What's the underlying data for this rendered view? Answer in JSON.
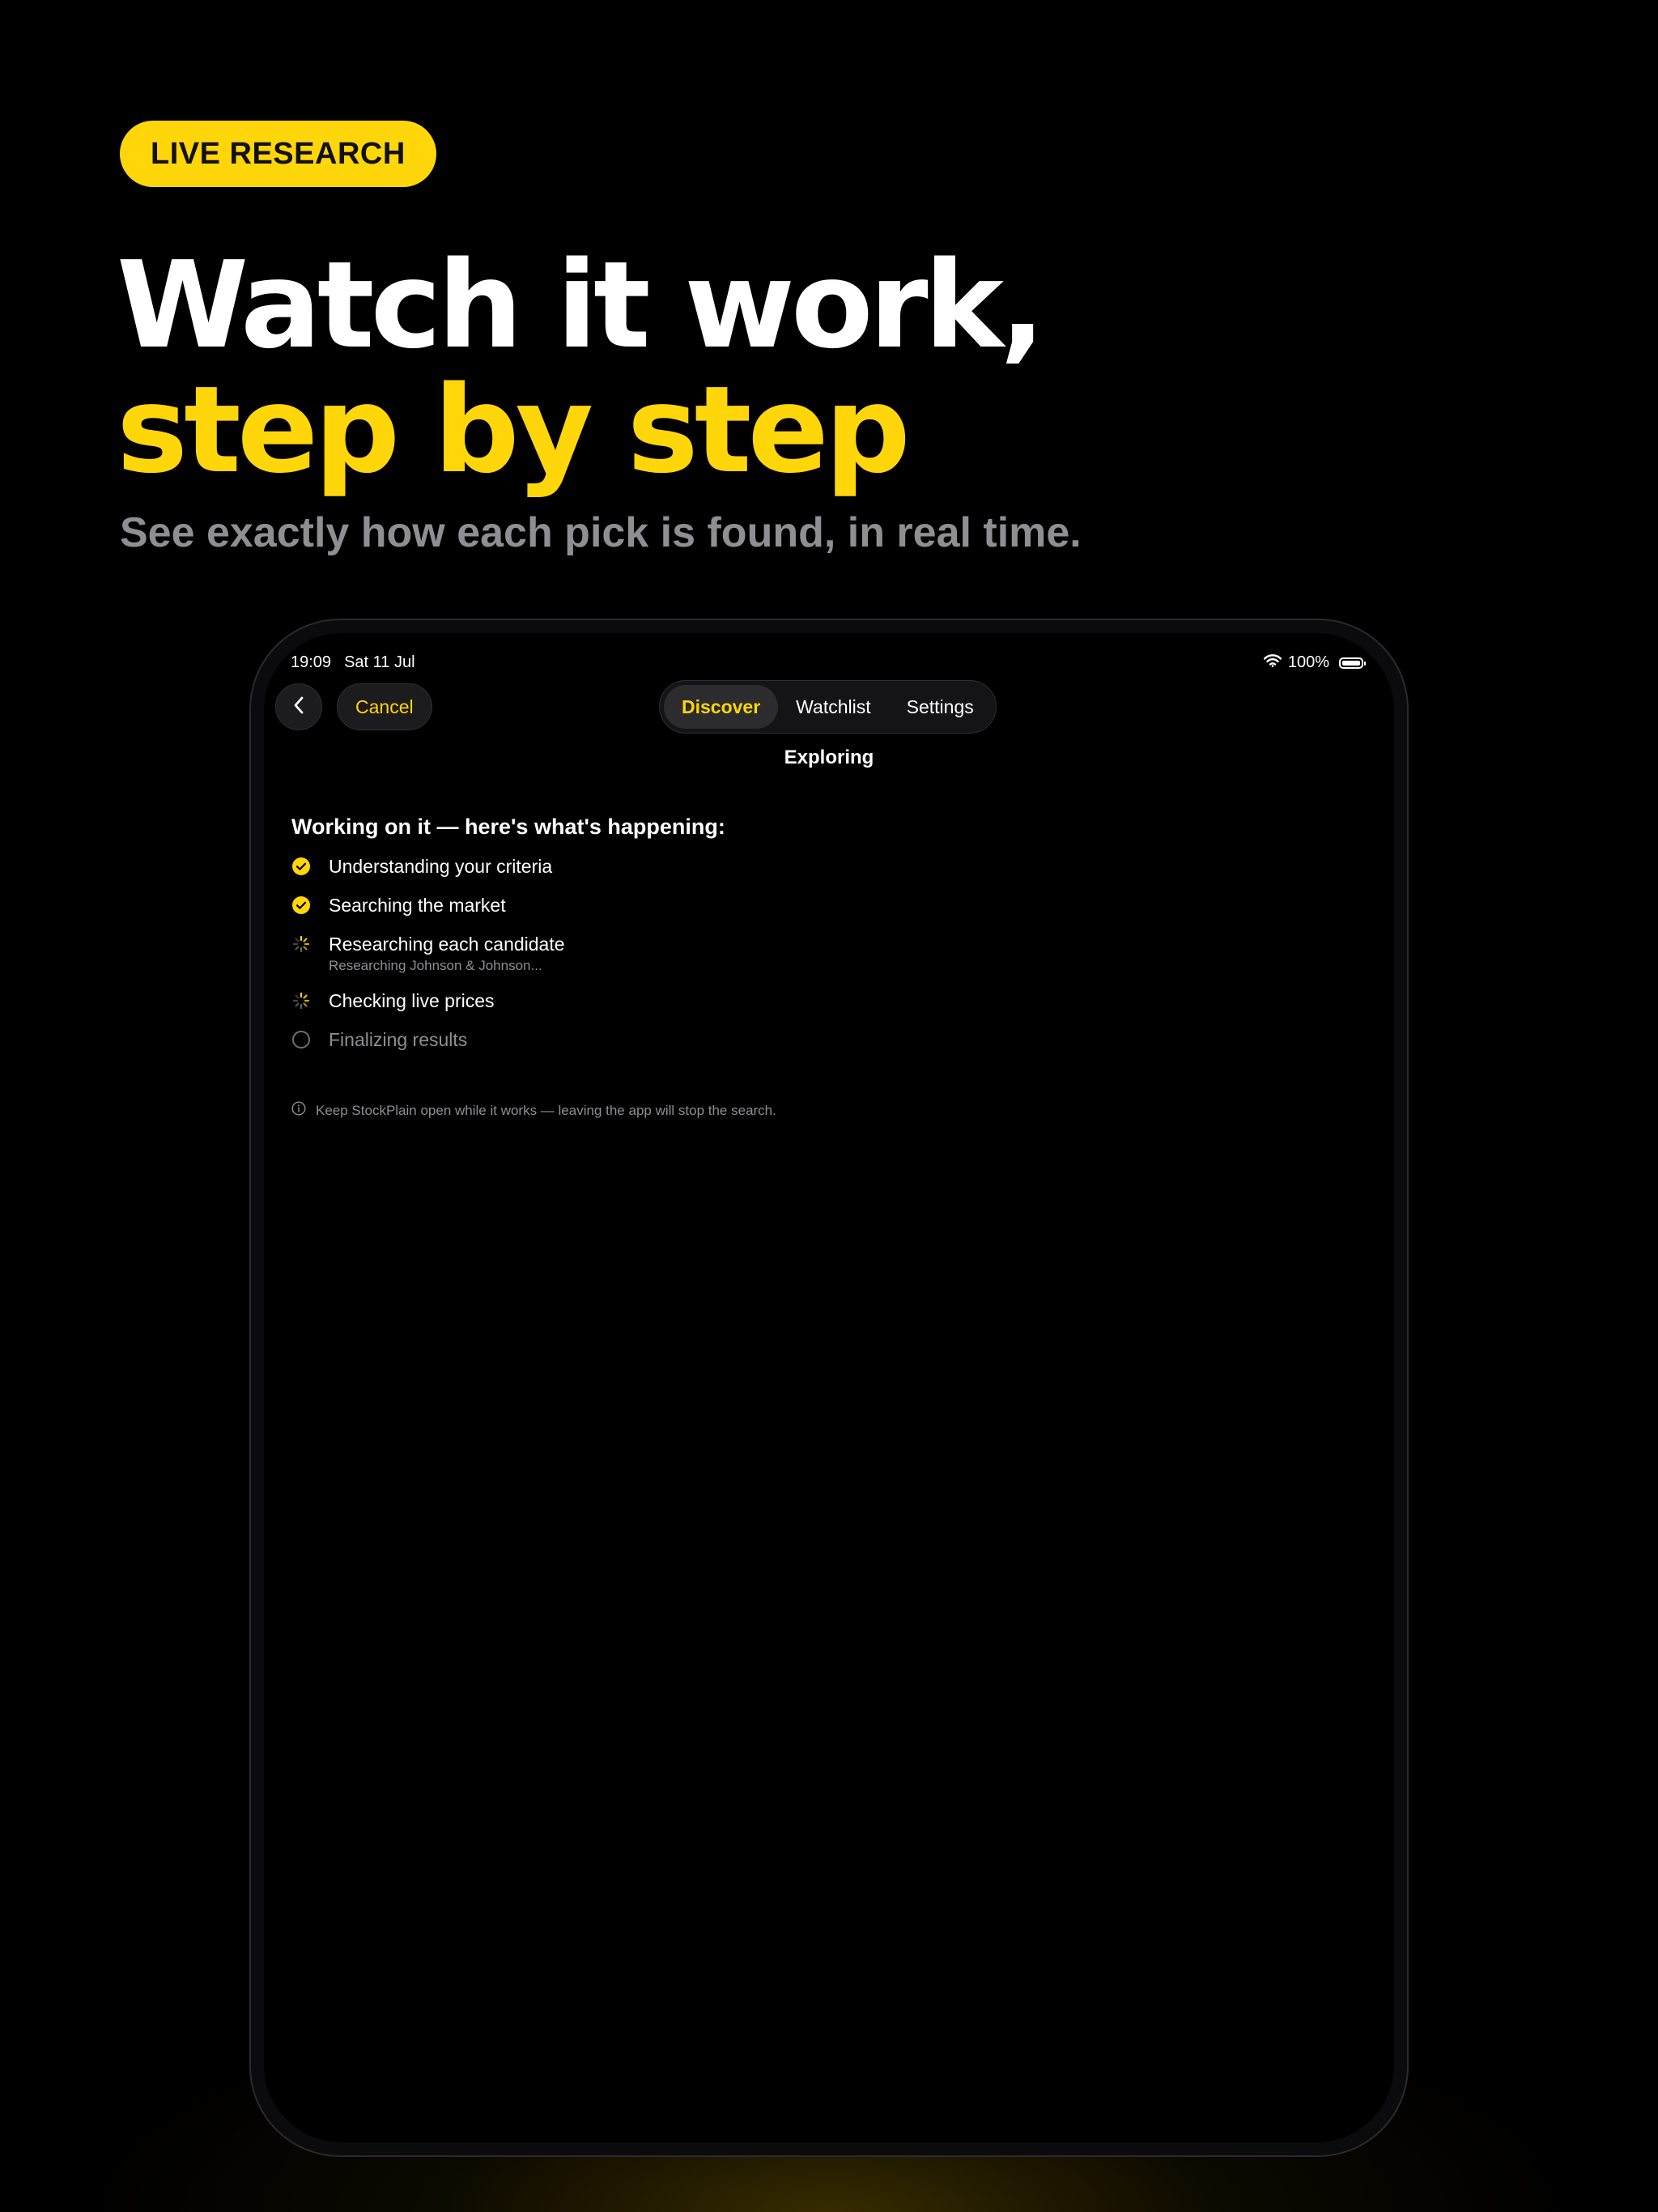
{
  "promo": {
    "badge": "LIVE RESEARCH",
    "headline_line1": "Watch it work,",
    "headline_line2": "step by step",
    "subtitle": "See exactly how each pick is found, in real time."
  },
  "status_bar": {
    "time": "19:09",
    "date": "Sat 11 Jul",
    "battery": "100%"
  },
  "nav": {
    "cancel_label": "Cancel",
    "tabs": [
      {
        "label": "Discover",
        "active": true
      },
      {
        "label": "Watchlist",
        "active": false
      },
      {
        "label": "Settings",
        "active": false
      }
    ]
  },
  "screen": {
    "title": "Exploring",
    "heading": "Working on it — here's what's happening:",
    "steps": [
      {
        "label": "Understanding your criteria",
        "state": "done"
      },
      {
        "label": "Searching the market",
        "state": "done"
      },
      {
        "label": "Researching each candidate",
        "detail": "Researching Johnson & Johnson...",
        "state": "in-progress"
      },
      {
        "label": "Checking live prices",
        "state": "in-progress"
      },
      {
        "label": "Finalizing results",
        "state": "pending"
      }
    ],
    "footnote": "Keep StockPlain open while it works — leaving the app will stop the search."
  },
  "colors": {
    "accent": "#ffd60a",
    "background": "#000000",
    "muted_text": "#8e8e93"
  },
  "icons": [
    "wifi-icon",
    "battery-icon",
    "chevron-left-icon",
    "check-circle-icon",
    "spinner-icon",
    "empty-circle-icon",
    "info-icon"
  ]
}
